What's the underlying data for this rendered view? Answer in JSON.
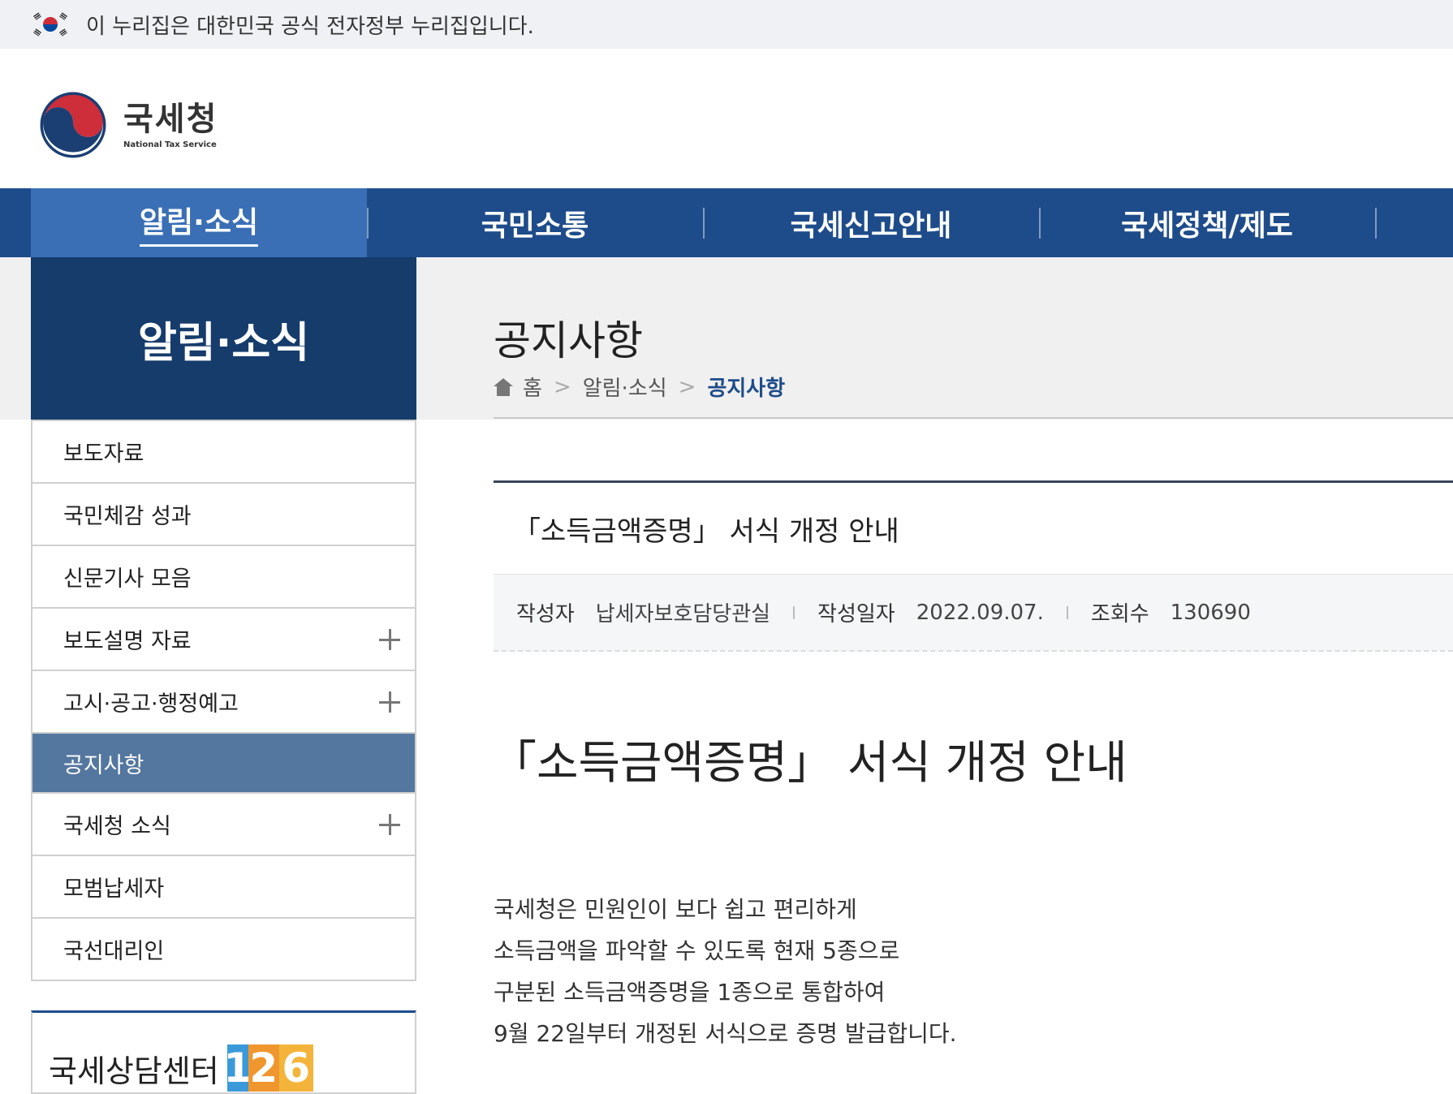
{
  "gov_banner": {
    "text": "이 누리집은 대한민국 공식 전자정부 누리집입니다."
  },
  "logo": {
    "name_kr": "국세청",
    "name_en": "National Tax Service"
  },
  "gnb": {
    "items": [
      {
        "label": "알림·소식",
        "active": true
      },
      {
        "label": "국민소통"
      },
      {
        "label": "국세신고안내"
      },
      {
        "label": "국세정책/제도"
      }
    ]
  },
  "sidebar": {
    "title": "알림·소식",
    "items": [
      {
        "label": "보도자료"
      },
      {
        "label": "국민체감 성과"
      },
      {
        "label": "신문기사 모음"
      },
      {
        "label": "보도설명 자료",
        "expandable": true
      },
      {
        "label": "고시·공고·행정예고",
        "expandable": true
      },
      {
        "label": "공지사항",
        "active": true
      },
      {
        "label": "국세청 소식",
        "expandable": true
      },
      {
        "label": "모범납세자"
      },
      {
        "label": "국선대리인"
      }
    ],
    "consult": {
      "label": "국세상담센터",
      "number": [
        "1",
        "2",
        "6"
      ]
    }
  },
  "main": {
    "page_title": "공지사항",
    "breadcrumb": [
      "홈",
      "알림·소식",
      "공지사항"
    ],
    "post": {
      "title": "「소득금액증명」 서식 개정 안내",
      "meta": {
        "author_label": "작성자",
        "author": "납세자보호담당관실",
        "date_label": "작성일자",
        "date": "2022.09.07.",
        "views_label": "조회수",
        "views": "130690"
      },
      "heading": "「소득금액증명」 서식 개정 안내",
      "body": [
        "국세청은 민원인이 보다 쉽고 편리하게",
        "소득금액을 파악할 수 있도록 현재 5종으로",
        "구분된 소득금액증명을 1종으로 통합하여",
        "9월 22일부터 개정된 서식으로 증명 발급합니다."
      ]
    }
  },
  "colors": {
    "primary": "#1e4c8a",
    "active_nav": "#3a6fb5",
    "sidebar_title": "#163c6b",
    "sidebar_active": "#54779f"
  }
}
